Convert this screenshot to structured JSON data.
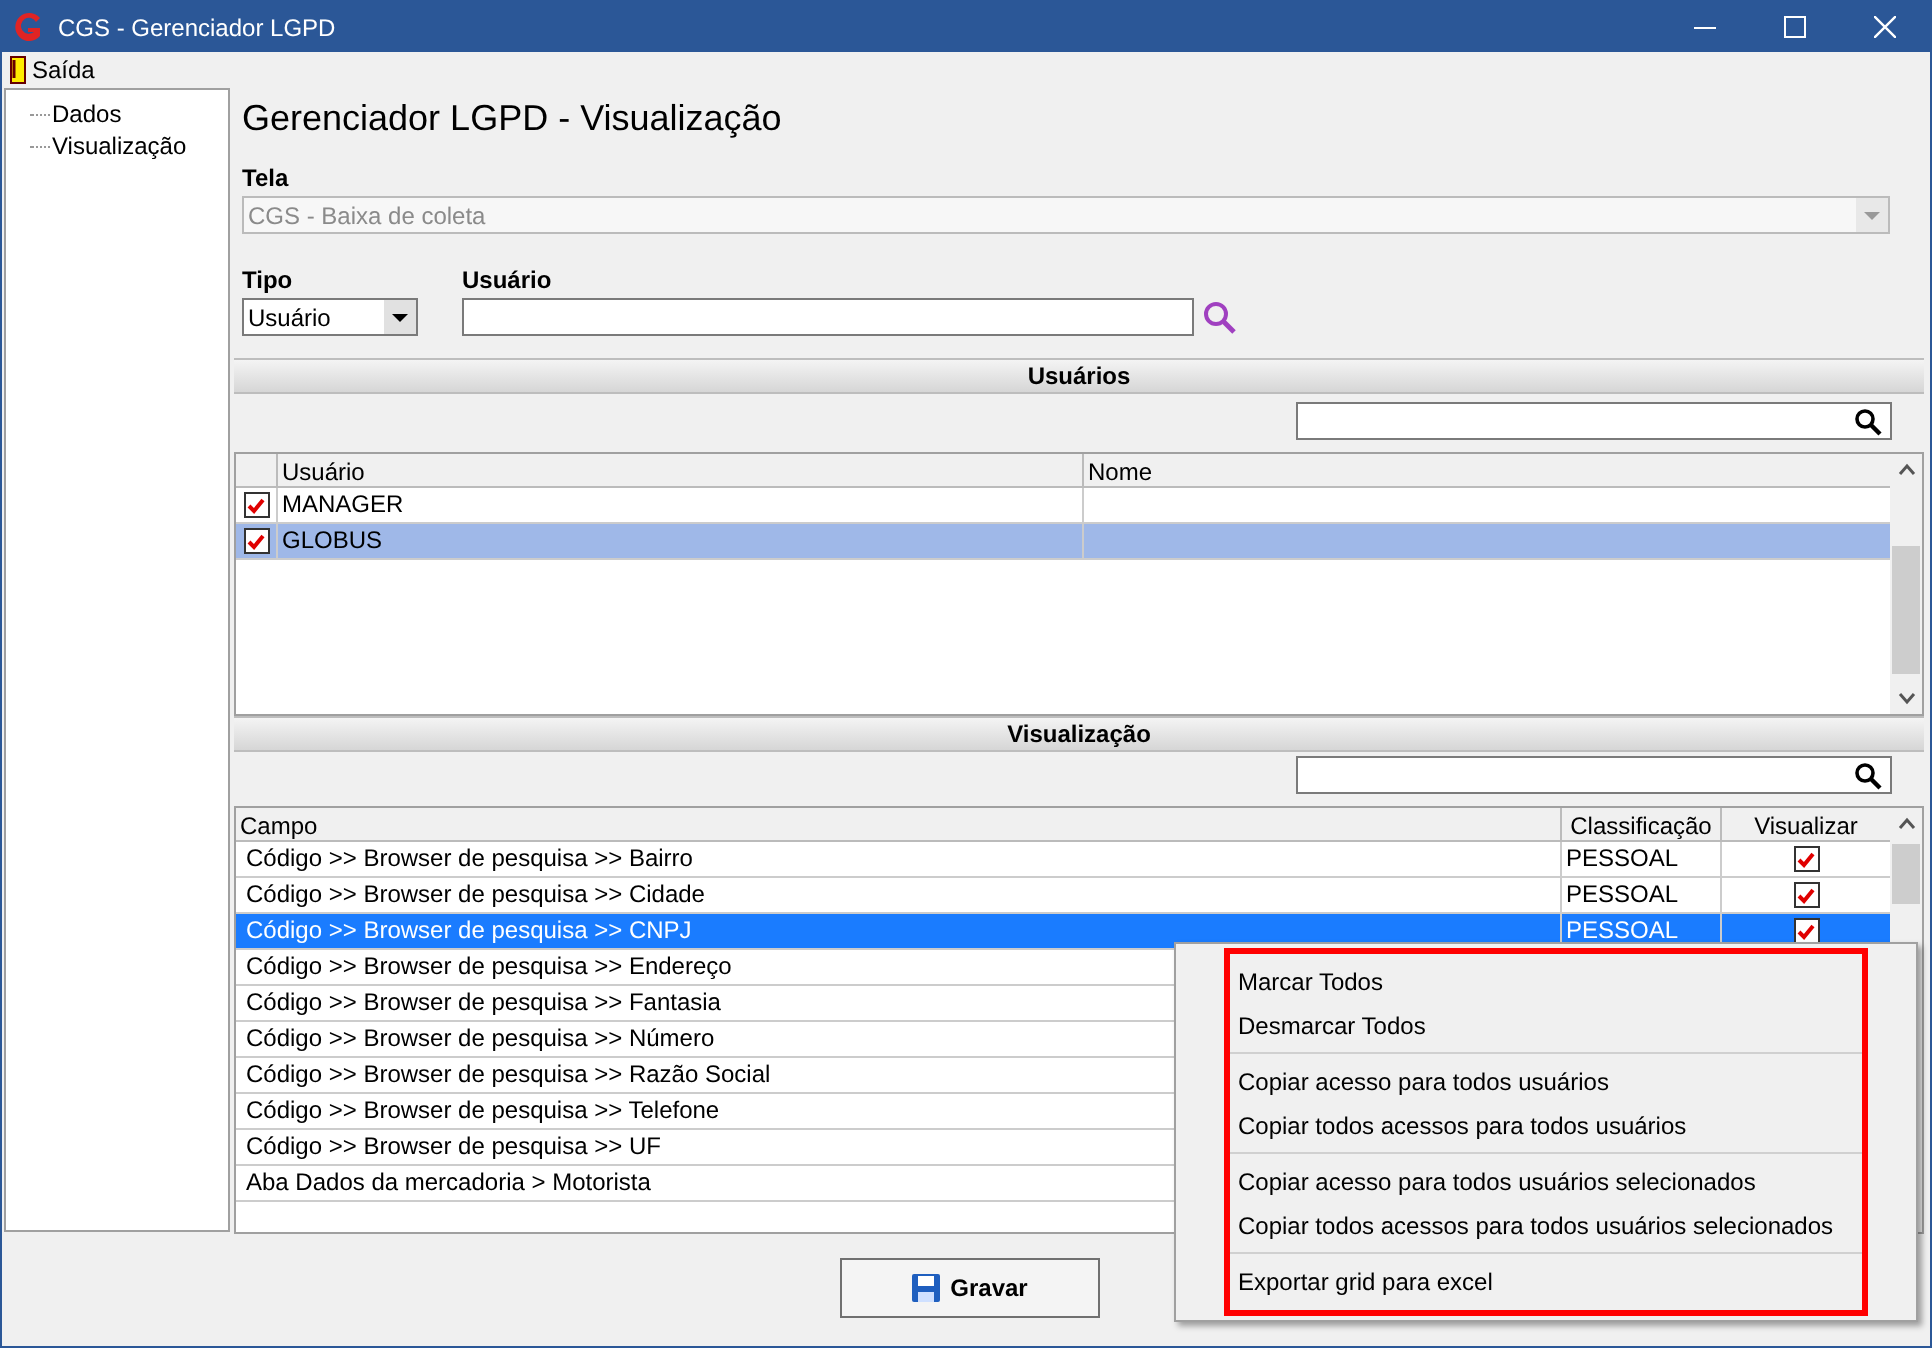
{
  "window": {
    "title": "CGS - Gerenciador LGPD"
  },
  "menu_bar": [
    {
      "label": "Saída"
    }
  ],
  "tree": {
    "items": [
      {
        "label": "Dados"
      },
      {
        "label": "Visualização"
      }
    ]
  },
  "page_title": "Gerenciador LGPD - Visualização",
  "tela": {
    "label": "Tela",
    "value": "CGS - Baixa de coleta",
    "disabled": true
  },
  "tipo": {
    "label": "Tipo",
    "value": "Usuário"
  },
  "usuario": {
    "label": "Usuário"
  },
  "users_section": {
    "title": "Usuários",
    "columns": [
      "Usuário",
      "Nome"
    ],
    "rows": [
      {
        "usuario": "MANAGER",
        "checked": true,
        "selected": false
      },
      {
        "usuario": "GLOBUS",
        "checked": true,
        "selected": true
      }
    ]
  },
  "view_section": {
    "title": "Visualização",
    "columns": [
      "Campo",
      "Classificação",
      "Visualizar"
    ],
    "rows": [
      {
        "campo": "Código >> Browser de pesquisa >> Bairro",
        "classificacao": "PESSOAL",
        "visualizar": true,
        "selected": false
      },
      {
        "campo": "Código >> Browser de pesquisa >> Cidade",
        "classificacao": "PESSOAL",
        "visualizar": true,
        "selected": false
      },
      {
        "campo": "Código >> Browser de pesquisa >> CNPJ",
        "classificacao": "PESSOAL",
        "visualizar": true,
        "selected": true
      },
      {
        "campo": "Código >> Browser de pesquisa >> Endereço",
        "selected": false
      },
      {
        "campo": "Código >> Browser de pesquisa >> Fantasia",
        "selected": false
      },
      {
        "campo": "Código >> Browser de pesquisa >> Número",
        "selected": false
      },
      {
        "campo": "Código >> Browser de pesquisa >> Razão Social",
        "selected": false
      },
      {
        "campo": "Código >> Browser de pesquisa >> Telefone",
        "selected": false
      },
      {
        "campo": "Código >> Browser de pesquisa >> UF",
        "selected": false
      },
      {
        "campo": "Aba Dados da mercadoria > Motorista",
        "selected": false
      }
    ]
  },
  "context_menu": {
    "groups": [
      [
        "Marcar Todos",
        "Desmarcar Todos"
      ],
      [
        "Copiar acesso para todos usuários",
        "Copiar todos acessos para todos usuários"
      ],
      [
        "Copiar acesso para todos usuários selecionados",
        "Copiar todos acessos para todos usuários selecionados"
      ],
      [
        "Exportar grid para excel"
      ]
    ]
  },
  "buttons": [
    {
      "label": "Gravar"
    }
  ]
}
